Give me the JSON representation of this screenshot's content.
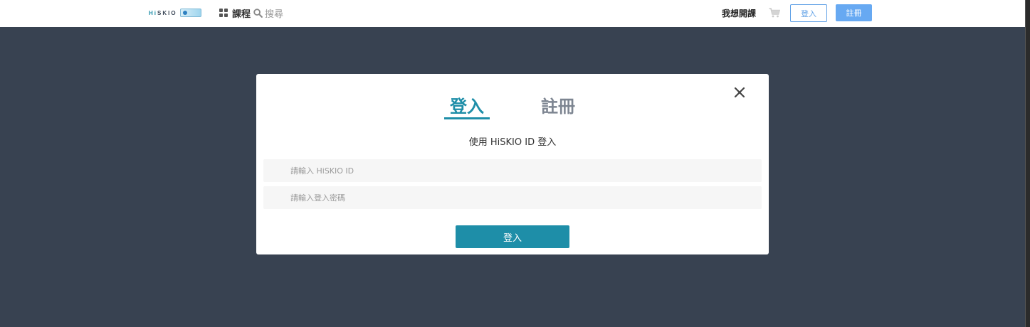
{
  "header": {
    "logo_text_hi": "Hi",
    "logo_text_rest": "SKIO",
    "courses_label": "課程",
    "search_label": "搜尋",
    "teach_label": "我想開課",
    "login_label": "登入",
    "register_label": "註冊"
  },
  "modal": {
    "tabs": [
      {
        "label": "登入",
        "active": true
      },
      {
        "label": "註冊",
        "active": false
      }
    ],
    "subtitle": "使用 HiSKIO ID 登入",
    "id_placeholder": "請輸入 HiSKIO ID",
    "password_placeholder": "請輸入登入密碼",
    "submit_label": "登入"
  },
  "colors": {
    "accent": "#1e8ea8",
    "overlay": "#384251",
    "top_button": "#67a9f2"
  },
  "icons": [
    "grid-icon",
    "search-icon",
    "cart-icon",
    "close-icon"
  ]
}
